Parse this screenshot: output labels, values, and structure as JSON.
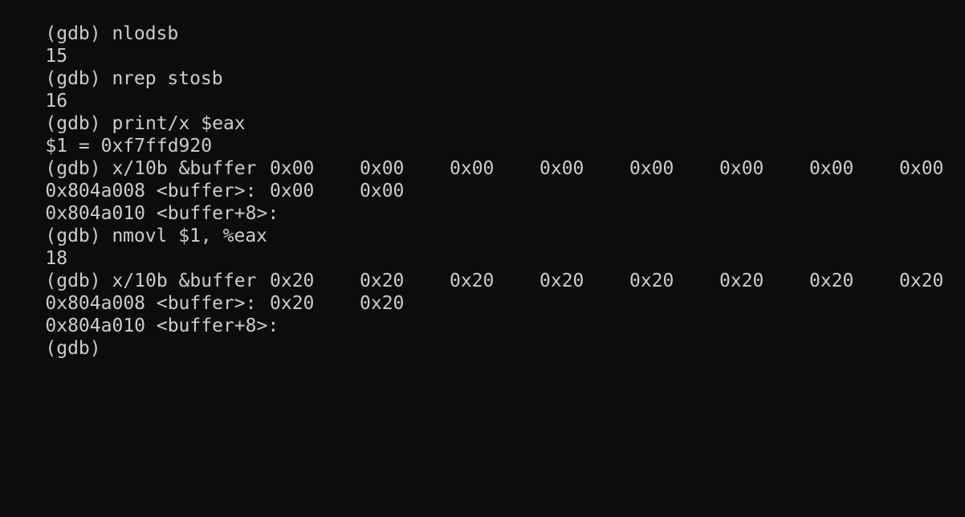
{
  "terminal": {
    "prompt": "(gdb)",
    "lines": [
      {
        "type": "cmd",
        "text": "(gdb) n"
      },
      {
        "type": "src",
        "lineno": "15",
        "code": "lodsb"
      },
      {
        "type": "cmd",
        "text": "(gdb) n"
      },
      {
        "type": "src",
        "lineno": "16",
        "code": "rep stosb"
      },
      {
        "type": "cmd",
        "text": "(gdb) print/x $eax"
      },
      {
        "type": "out",
        "text": "$1 = 0xf7ffd920"
      },
      {
        "type": "cmd",
        "text": "(gdb) x/10b &buffer"
      },
      {
        "type": "mem",
        "addr": "0x804a008 <buffer>:",
        "bytes": [
          "0x00",
          "0x00",
          "0x00",
          "0x00",
          "0x00",
          "0x00",
          "0x00",
          "0x00"
        ]
      },
      {
        "type": "mem",
        "addr": "0x804a010 <buffer+8>:",
        "bytes": [
          "0x00",
          "0x00"
        ]
      },
      {
        "type": "cmd",
        "text": "(gdb) n"
      },
      {
        "type": "src",
        "lineno": "18",
        "code": "movl $1, %eax"
      },
      {
        "type": "cmd",
        "text": "(gdb) x/10b &buffer"
      },
      {
        "type": "mem",
        "addr": "0x804a008 <buffer>:",
        "bytes": [
          "0x20",
          "0x20",
          "0x20",
          "0x20",
          "0x20",
          "0x20",
          "0x20",
          "0x20"
        ]
      },
      {
        "type": "mem",
        "addr": "0x804a010 <buffer+8>:",
        "bytes": [
          "0x20",
          "0x20"
        ]
      },
      {
        "type": "cmd",
        "text": "(gdb)"
      }
    ]
  }
}
